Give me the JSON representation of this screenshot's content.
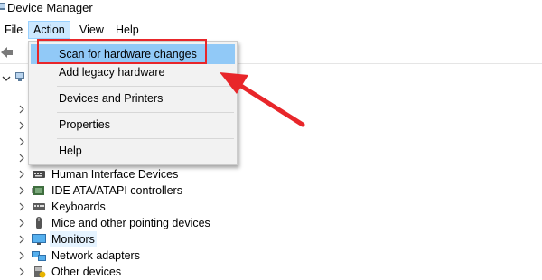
{
  "window": {
    "title": "Device Manager"
  },
  "menubar": {
    "items": [
      {
        "label": "File"
      },
      {
        "label": "Action"
      },
      {
        "label": "View"
      },
      {
        "label": "Help"
      }
    ]
  },
  "action_menu": {
    "items": [
      {
        "label": "Scan for hardware changes"
      },
      {
        "label": "Add legacy hardware"
      },
      {
        "label": "Devices and Printers"
      },
      {
        "label": "Properties"
      },
      {
        "label": "Help"
      }
    ]
  },
  "tree": {
    "nodes": [
      {
        "label": "Human Interface Devices",
        "icon": "hid-icon"
      },
      {
        "label": "IDE ATA/ATAPI controllers",
        "icon": "ide-controller-icon"
      },
      {
        "label": "Keyboards",
        "icon": "keyboard-icon"
      },
      {
        "label": "Mice and other pointing devices",
        "icon": "mouse-icon"
      },
      {
        "label": "Monitors",
        "icon": "monitor-icon"
      },
      {
        "label": "Network adapters",
        "icon": "network-adapter-icon"
      },
      {
        "label": "Other devices",
        "icon": "other-devices-icon"
      }
    ]
  },
  "annotation": {
    "highlight_color": "#e8262a"
  }
}
